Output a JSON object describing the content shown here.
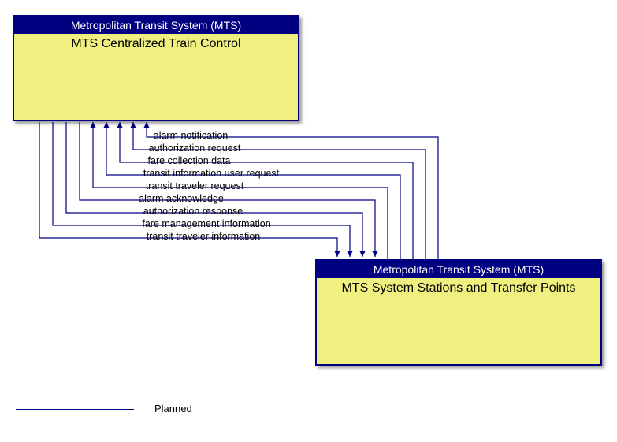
{
  "box1": {
    "header": "Metropolitan Transit System (MTS)",
    "body": "MTS Centralized Train Control"
  },
  "box2": {
    "header": "Metropolitan Transit System (MTS)",
    "body": "MTS System Stations and Transfer Points"
  },
  "flows": {
    "f0": "alarm notification",
    "f1": "authorization request",
    "f2": "fare collection data",
    "f3": "transit information user request",
    "f4": "transit traveler request",
    "f5": "alarm acknowledge",
    "f6": "authorization response",
    "f7": "fare management information",
    "f8": "transit traveler information"
  },
  "legend": {
    "planned": "Planned"
  }
}
